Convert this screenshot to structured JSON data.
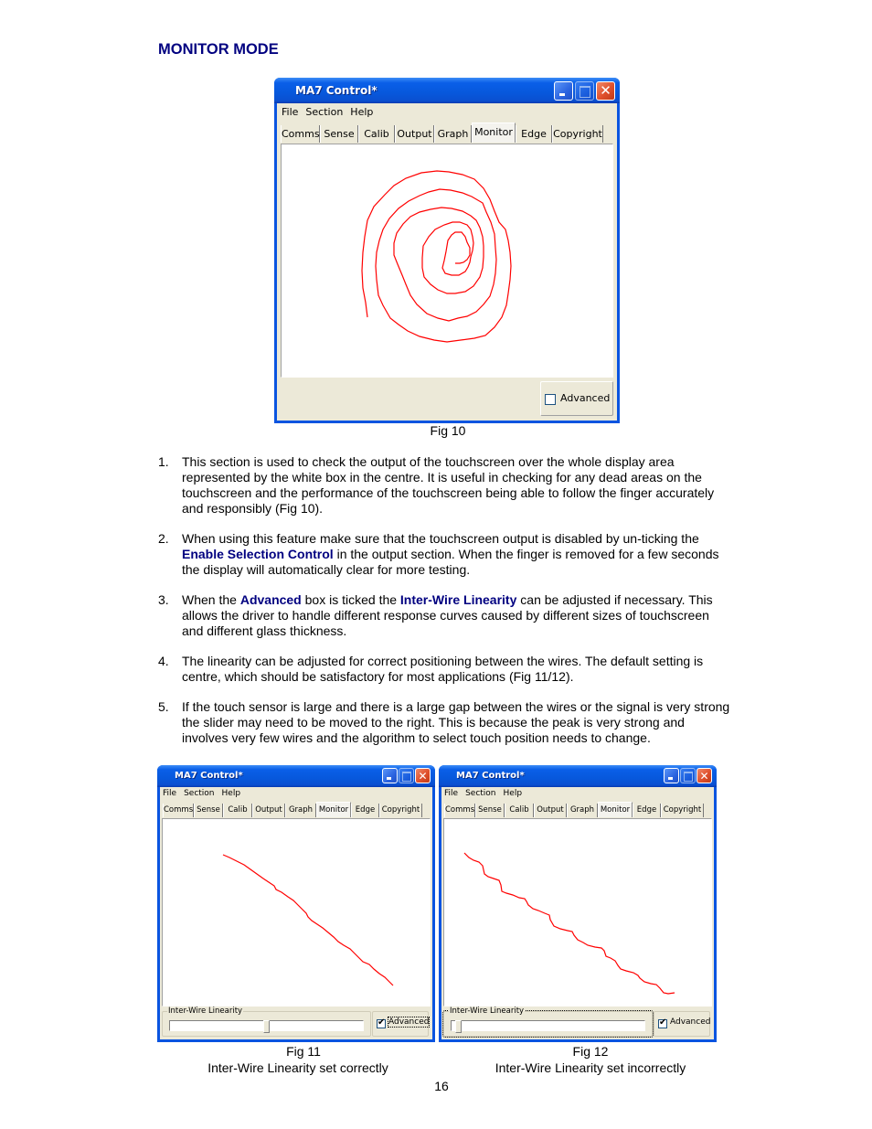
{
  "heading": "MONITOR MODE",
  "window": {
    "title": "MA7 Control*",
    "menu": [
      "File",
      "Section",
      "Help"
    ],
    "tabs": [
      "Comms",
      "Sense",
      "Calib",
      "Output",
      "Graph",
      "Monitor",
      "Edge",
      "Copyright"
    ],
    "active_tab": "Monitor",
    "advanced_label": "Advanced",
    "slider_group_label": "Inter-Wire Linearity",
    "trace_color": "#ff0000"
  },
  "figures": [
    {
      "id": "fig10",
      "caption": "Fig 10",
      "subcaption": "",
      "advanced_checked": false,
      "show_slider": false,
      "trace": "spiral"
    },
    {
      "id": "fig11",
      "caption": "Fig 11",
      "subcaption": "Inter-Wire Linearity set correctly",
      "advanced_checked": true,
      "show_slider": true,
      "slider_value_pct": 50,
      "trace": "smooth diagonal"
    },
    {
      "id": "fig12",
      "caption": "Fig 12",
      "subcaption": "Inter-Wire Linearity set incorrectly",
      "advanced_checked": true,
      "show_slider": true,
      "slider_value_pct": 2,
      "trace": "stepped diagonal"
    }
  ],
  "items": [
    {
      "num": "1.",
      "parts": [
        {
          "t": "This section is used to check the output of the touchscreen over the whole display area represented by the white box in the centre. It is useful in checking for any dead areas on the touchscreen and the performance of the touchscreen being able to follow the finger accurately and responsibly (Fig 10)."
        }
      ]
    },
    {
      "num": "2.",
      "parts": [
        {
          "t": "When using this feature make sure that the touchscreen output is disabled by un-ticking the "
        },
        {
          "t": "Enable Selection Control",
          "em": true
        },
        {
          "t": " in the output section. When the finger is removed for a few seconds the display will automatically clear for more testing."
        }
      ]
    },
    {
      "num": "3.",
      "parts": [
        {
          "t": "When the "
        },
        {
          "t": "Advanced",
          "em": true
        },
        {
          "t": " box is ticked the "
        },
        {
          "t": "Inter-Wire Linearity",
          "em": true
        },
        {
          "t": " can be adjusted if necessary. This allows the driver to handle different response curves caused by different sizes of touchscreen and different glass thickness."
        }
      ]
    },
    {
      "num": "4.",
      "parts": [
        {
          "t": "The linearity can be adjusted for correct positioning between the wires. The default setting is centre, which should be satisfactory for most applications (Fig 11/12)."
        }
      ]
    },
    {
      "num": "5.",
      "parts": [
        {
          "t": "If the touch sensor is large and there is a large gap between the wires or the signal is very strong the slider may need to be moved to the right. This is because the peak is very strong and involves very few wires and the algorithm to select touch position needs to change."
        }
      ]
    }
  ],
  "page_number": "16"
}
